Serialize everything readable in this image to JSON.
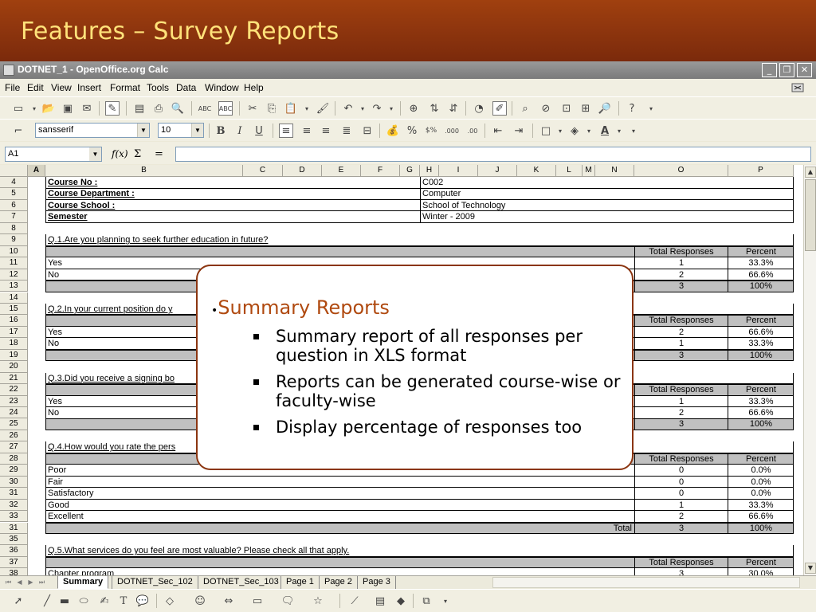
{
  "slide": {
    "title": "Features – Survey Reports"
  },
  "window": {
    "title": "DOTNET_1 - OpenOffice.org Calc"
  },
  "menu": [
    "File",
    "Edit",
    "View",
    "Insert",
    "Format",
    "Tools",
    "Data",
    "Window",
    "Help"
  ],
  "format_bar": {
    "font_name": "sansserif",
    "font_size": "10"
  },
  "formula_bar": {
    "cell_ref": "A1",
    "func_label": "f(x)",
    "sum_label": "Σ",
    "equals_label": "="
  },
  "columns": [
    "A",
    "B",
    "C",
    "D",
    "E",
    "F",
    "G",
    "H",
    "I",
    "J",
    "K",
    "L",
    "M",
    "N",
    "O",
    "P"
  ],
  "rows": [
    {
      "n": "4",
      "b": "Course No :",
      "h": "C002",
      "bold": true
    },
    {
      "n": "5",
      "b": "Course Department :",
      "h": "Computer",
      "bold": true
    },
    {
      "n": "6",
      "b": "Course School :",
      "h": "School of Technology",
      "bold": true
    },
    {
      "n": "7",
      "b": "Semester",
      "h": "Winter - 2009",
      "bold": true
    },
    {
      "n": "8"
    },
    {
      "n": "9",
      "b": "Q.1.Are you planning to seek further education in future?"
    },
    {
      "n": "10",
      "o": "Total Responses",
      "p": "Percent",
      "gray": true
    },
    {
      "n": "11",
      "b": "Yes",
      "o": "1",
      "p": "33.3%"
    },
    {
      "n": "12",
      "b": "No",
      "o": "2",
      "p": "66.6%"
    },
    {
      "n": "13",
      "o": "3",
      "p": "100%",
      "gray": true
    },
    {
      "n": "14"
    },
    {
      "n": "15",
      "b": "Q.2.In your current position do y"
    },
    {
      "n": "16",
      "o": "Total Responses",
      "p": "Percent",
      "gray": true
    },
    {
      "n": "17",
      "b": "Yes",
      "o": "2",
      "p": "66.6%"
    },
    {
      "n": "18",
      "b": "No",
      "o": "1",
      "p": "33.3%"
    },
    {
      "n": "19",
      "o": "3",
      "p": "100%",
      "gray": true
    },
    {
      "n": "20"
    },
    {
      "n": "21",
      "b": "Q.3.Did you receive a signing bo"
    },
    {
      "n": "22",
      "o": "Total Responses",
      "p": "Percent",
      "gray": true
    },
    {
      "n": "23",
      "b": "Yes",
      "o": "1",
      "p": "33.3%"
    },
    {
      "n": "24",
      "b": "No",
      "o": "2",
      "p": "66.6%"
    },
    {
      "n": "25",
      "o": "3",
      "p": "100%",
      "gray": true
    },
    {
      "n": "26"
    },
    {
      "n": "27",
      "b": "Q.4.How would you rate the pers"
    },
    {
      "n": "28",
      "o": "Total Responses",
      "p": "Percent",
      "gray": true
    },
    {
      "n": "29",
      "b": "Poor",
      "o": "0",
      "p": "0.0%"
    },
    {
      "n": "30",
      "b": "Fair",
      "o": "0",
      "p": "0.0%"
    },
    {
      "n": "31",
      "b": "Satisfactory",
      "o": "0",
      "p": "0.0%"
    },
    {
      "n": "32",
      "b": "Good",
      "o": "1",
      "p": "33.3%"
    },
    {
      "n": "33",
      "b": "Excellent",
      "o": "2",
      "p": "66.6%"
    },
    {
      "n": "31",
      "n_label": "Total",
      "o": "3",
      "p": "100%",
      "gray": true
    },
    {
      "n": "35"
    },
    {
      "n": "36",
      "b": "Q.5.What services do you feel are most valuable? Please check all that apply."
    },
    {
      "n": "37",
      "o": "Total Responses",
      "p": "Percent",
      "gray": true
    },
    {
      "n": "38",
      "b": "Chapter program",
      "o": "3",
      "p": "30.0%"
    }
  ],
  "sheet_tabs": [
    "Summary",
    "DOTNET_Sec_102",
    "DOTNET_Sec_103",
    "Page 1",
    "Page 2",
    "Page 3"
  ],
  "callout": {
    "heading": "Summary Reports",
    "bullets": [
      "Summary report of all responses per question in XLS format",
      "Reports can be generated course-wise or faculty-wise",
      "Display  percentage of responses too"
    ]
  },
  "colors": {
    "slide_bg": "#7a2a0d",
    "title": "#ffe27a",
    "callout_border": "#8b3510",
    "callout_heading": "#b04a10"
  }
}
